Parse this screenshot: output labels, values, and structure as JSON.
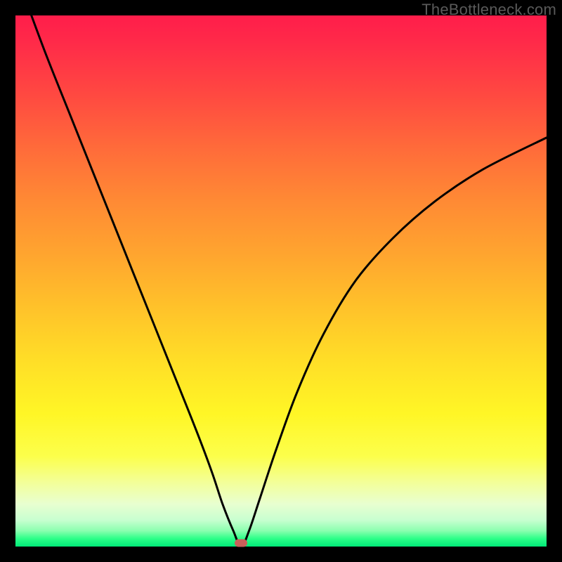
{
  "watermark": "TheBottleneck.com",
  "marker": {
    "x_pct": 42.5,
    "y_pct": 99.3
  },
  "chart_data": {
    "type": "line",
    "title": "",
    "xlabel": "",
    "ylabel": "",
    "xlim": [
      0,
      100
    ],
    "ylim": [
      0,
      100
    ],
    "x": [
      3,
      6,
      10,
      14,
      18,
      22,
      26,
      30,
      34,
      37,
      39,
      41,
      42.5,
      44,
      46,
      49,
      53,
      58,
      64,
      71,
      79,
      88,
      100
    ],
    "y": [
      100,
      92,
      82,
      72,
      62,
      52,
      42,
      32,
      22,
      14,
      8,
      3,
      0,
      3,
      9,
      18,
      29,
      40,
      50,
      58,
      65,
      71,
      77
    ],
    "series": [
      {
        "name": "bottleneck-curve",
        "color": "#000000"
      }
    ],
    "grid": false,
    "legend": false
  }
}
